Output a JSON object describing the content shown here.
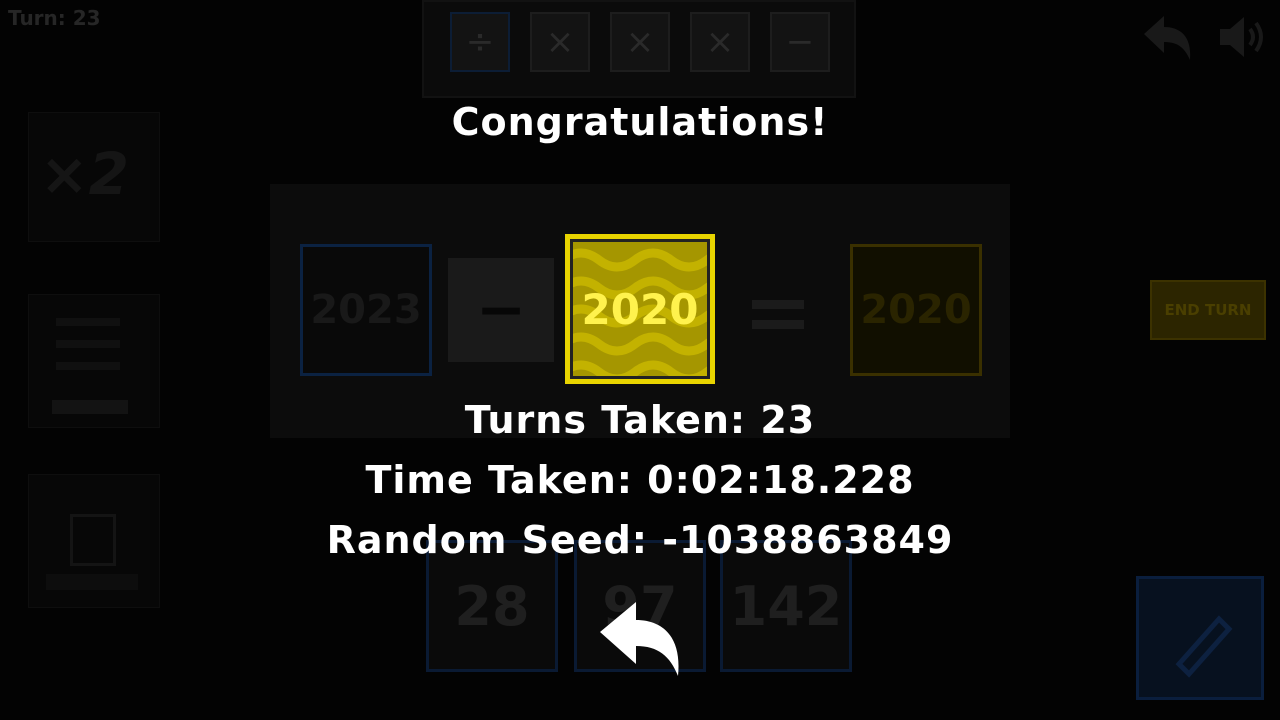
{
  "hud": {
    "turn_label": "Turn: 23"
  },
  "background": {
    "operators": [
      "÷",
      "×",
      "×",
      "×",
      "−"
    ],
    "equation": {
      "left_operand": "2023",
      "operator": "−",
      "result": "2020"
    },
    "end_turn_label": "END TURN",
    "number_tiles": [
      "28",
      "97",
      "142"
    ]
  },
  "overlay": {
    "title": "Congratulations!",
    "goal_value": "2020",
    "turns_taken": "Turns Taken: 23",
    "time_taken": "Time Taken: 0:02:18.228",
    "random_seed": "Random Seed: -1038863849"
  },
  "icons": {
    "back": "back-arrow-icon",
    "undo": "undo-icon",
    "sound": "speaker-icon"
  },
  "colors": {
    "goal_tile": "#e8d400",
    "goal_text": "#fff24d",
    "overlay_text": "#ffffff",
    "backdrop": "#030303"
  }
}
